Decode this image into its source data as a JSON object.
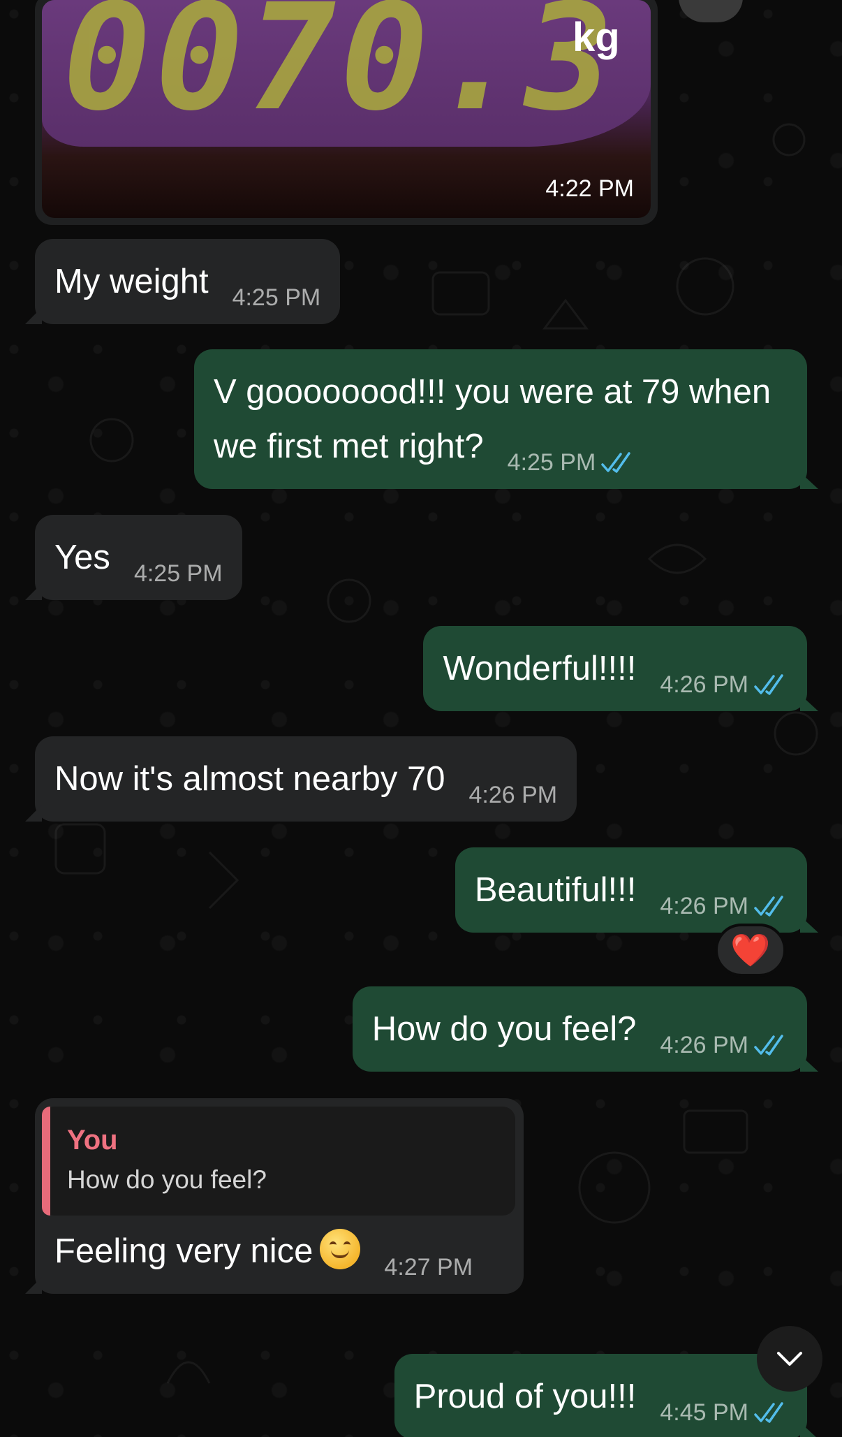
{
  "photo": {
    "display_digits": "0070.3",
    "unit": "kg",
    "time": "4:22 PM"
  },
  "messages": [
    {
      "id": "m1",
      "direction": "incoming",
      "text": "My weight",
      "time": "4:25 PM"
    },
    {
      "id": "m2",
      "direction": "outgoing",
      "text": "V goooooood!!! you were at 79 when we first met right?",
      "time": "4:25 PM",
      "read": true
    },
    {
      "id": "m3",
      "direction": "incoming",
      "text": "Yes",
      "time": "4:25 PM"
    },
    {
      "id": "m4",
      "direction": "outgoing",
      "text": "Wonderful!!!!",
      "time": "4:26 PM",
      "read": true
    },
    {
      "id": "m5",
      "direction": "incoming",
      "text": "Now it's almost nearby 70",
      "time": "4:26 PM"
    },
    {
      "id": "m6",
      "direction": "outgoing",
      "text": "Beautiful!!!",
      "time": "4:26 PM",
      "read": true,
      "reaction": "❤️"
    },
    {
      "id": "m7",
      "direction": "outgoing",
      "text": "How do you feel?",
      "time": "4:26 PM",
      "read": true
    },
    {
      "id": "m8",
      "direction": "incoming",
      "text": "Feeling very nice",
      "time": "4:27 PM",
      "reply_to": {
        "author": "You",
        "text": "How do you feel?"
      }
    },
    {
      "id": "m9",
      "direction": "outgoing",
      "text": "Proud of you!!!",
      "time": "4:45 PM",
      "read": true
    }
  ],
  "colors": {
    "background": "#0b0b0b",
    "incoming_bubble": "#242526",
    "outgoing_bubble": "#1f4a34",
    "read_ticks": "#53bdeb",
    "quote_accent": "#e86b7a"
  },
  "icons": {
    "read_receipt": "double-check-icon",
    "scroll_down": "chevron-down-icon",
    "forward": "forward-icon",
    "reaction": "heart-icon"
  }
}
